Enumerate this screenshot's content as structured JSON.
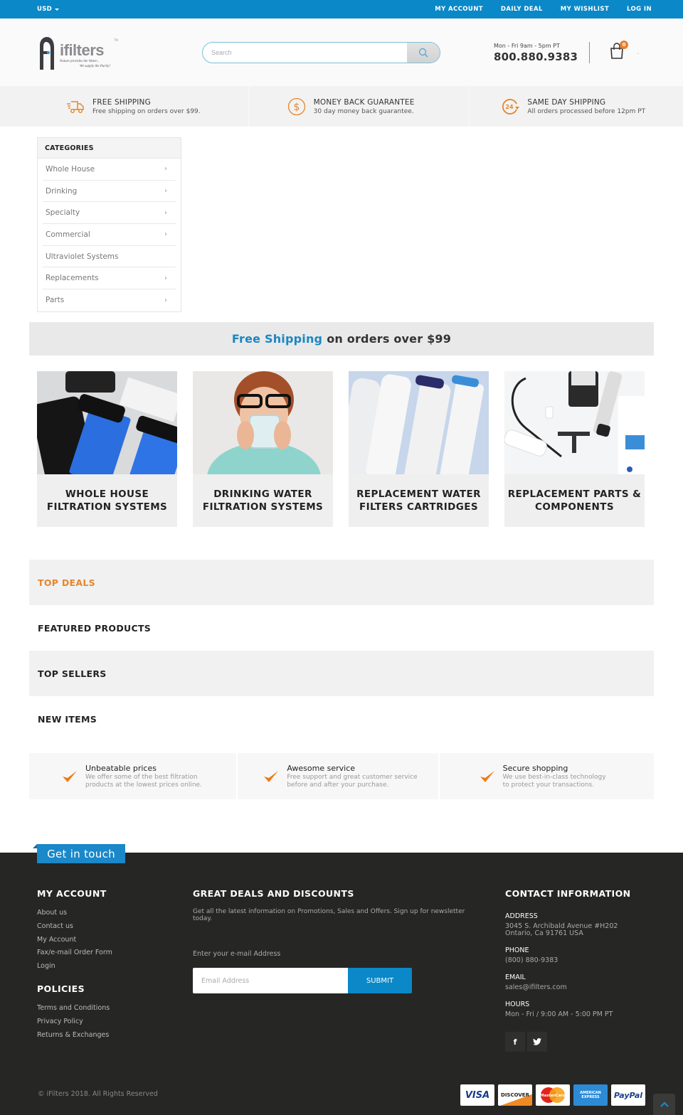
{
  "topbar": {
    "currency": "USD",
    "nav": [
      "MY ACCOUNT",
      "DAILY DEAL",
      "MY WISHLIST",
      "LOG IN"
    ]
  },
  "header": {
    "logo": {
      "word": "ifilters",
      "tm": "TM",
      "tagline1": "Nature provides the Water...",
      "tagline2": "We supply the Purity!"
    },
    "search_placeholder": "Search",
    "hours": "Mon - Fri 9am - 5pm PT",
    "phone": "800.880.9383",
    "cart_count": "0"
  },
  "benefits": [
    {
      "icon": "truck-icon",
      "title": "FREE SHIPPING",
      "sub": "Free shipping on orders over $99."
    },
    {
      "icon": "dollar-icon",
      "title": "MONEY BACK GUARANTEE",
      "sub": "30 day money back guarantee."
    },
    {
      "icon": "24h-icon",
      "title": "SAME DAY SHIPPING",
      "sub": "All orders processed before 12pm PT"
    }
  ],
  "categories": {
    "title": "CATEGORIES",
    "items": [
      {
        "label": "Whole House",
        "has_sub": true
      },
      {
        "label": "Drinking",
        "has_sub": true
      },
      {
        "label": "Specialty",
        "has_sub": true
      },
      {
        "label": "Commercial",
        "has_sub": true
      },
      {
        "label": "Ultraviolet Systems",
        "has_sub": false
      },
      {
        "label": "Replacements",
        "has_sub": true
      },
      {
        "label": "Parts",
        "has_sub": true
      }
    ]
  },
  "promo": {
    "highlight": "Free Shipping",
    "rest": "on orders over $99"
  },
  "tiles": [
    {
      "line1": "WHOLE HOUSE",
      "line2": "FILTRATION SYSTEMS"
    },
    {
      "line1": "DRINKING WATER",
      "line2": "FILTRATION SYSTEMS"
    },
    {
      "line1": "REPLACEMENT WATER",
      "line2": "FILTERS CARTRIDGES"
    },
    {
      "line1": "REPLACEMENT PARTS &",
      "line2": "COMPONENTS"
    }
  ],
  "sections": [
    "TOP DEALS",
    "FEATURED PRODUCTS",
    "TOP SELLERS",
    "NEW ITEMS"
  ],
  "promises": [
    {
      "title": "Unbeatable prices",
      "line1": "We offer some of the best filtration",
      "line2": "products at the lowest prices online."
    },
    {
      "title": "Awesome service",
      "line1": "Free support and great customer service",
      "line2": "before and after your purchase."
    },
    {
      "title": "Secure shopping",
      "line1": "We use best-in-class technology",
      "line2": "to protect your transactions."
    }
  ],
  "footer": {
    "get_in_touch": "Get in touch",
    "my_account": {
      "title": "MY ACCOUNT",
      "links": [
        "About us",
        "Contact us",
        "My Account",
        "Fax/e-mail Order Form",
        "Login"
      ]
    },
    "policies": {
      "title": "POLICIES",
      "links": [
        "Terms and Conditions",
        "Privacy Policy",
        "Returns & Exchanges"
      ]
    },
    "newsletter": {
      "title": "GREAT DEALS AND DISCOUNTS",
      "desc1": "Get all the latest information on Promotions, Sales and Offers. Sign up for newsletter",
      "desc2": "today.",
      "label": "Enter your e-mail Address",
      "placeholder": "Email Address",
      "submit": "SUBMIT"
    },
    "contact": {
      "title": "CONTACT INFORMATION",
      "address_label": "ADDRESS",
      "address1": "3045 S. Archibald Avenue #H202",
      "address2": "Ontario, Ca 91761 USA",
      "phone_label": "PHONE",
      "phone": "(800) 880-9383",
      "email_label": "EMAIL",
      "email": "sales@ifilters.com",
      "hours_label": "HOURS",
      "hours": "Mon - Fri / 9:00 AM - 5:00 PM PT",
      "social": [
        "f",
        "t"
      ]
    },
    "copyright": "© iFilters 2018. All Rights Reserved",
    "payments": [
      "VISA",
      "DISCOVER",
      "MasterCard",
      "AMERICAN EXPRESS",
      "PayPal"
    ]
  },
  "colors": {
    "brand_blue": "#0a88c8",
    "accent_orange": "#e5862b",
    "footer_bg": "#262624"
  }
}
